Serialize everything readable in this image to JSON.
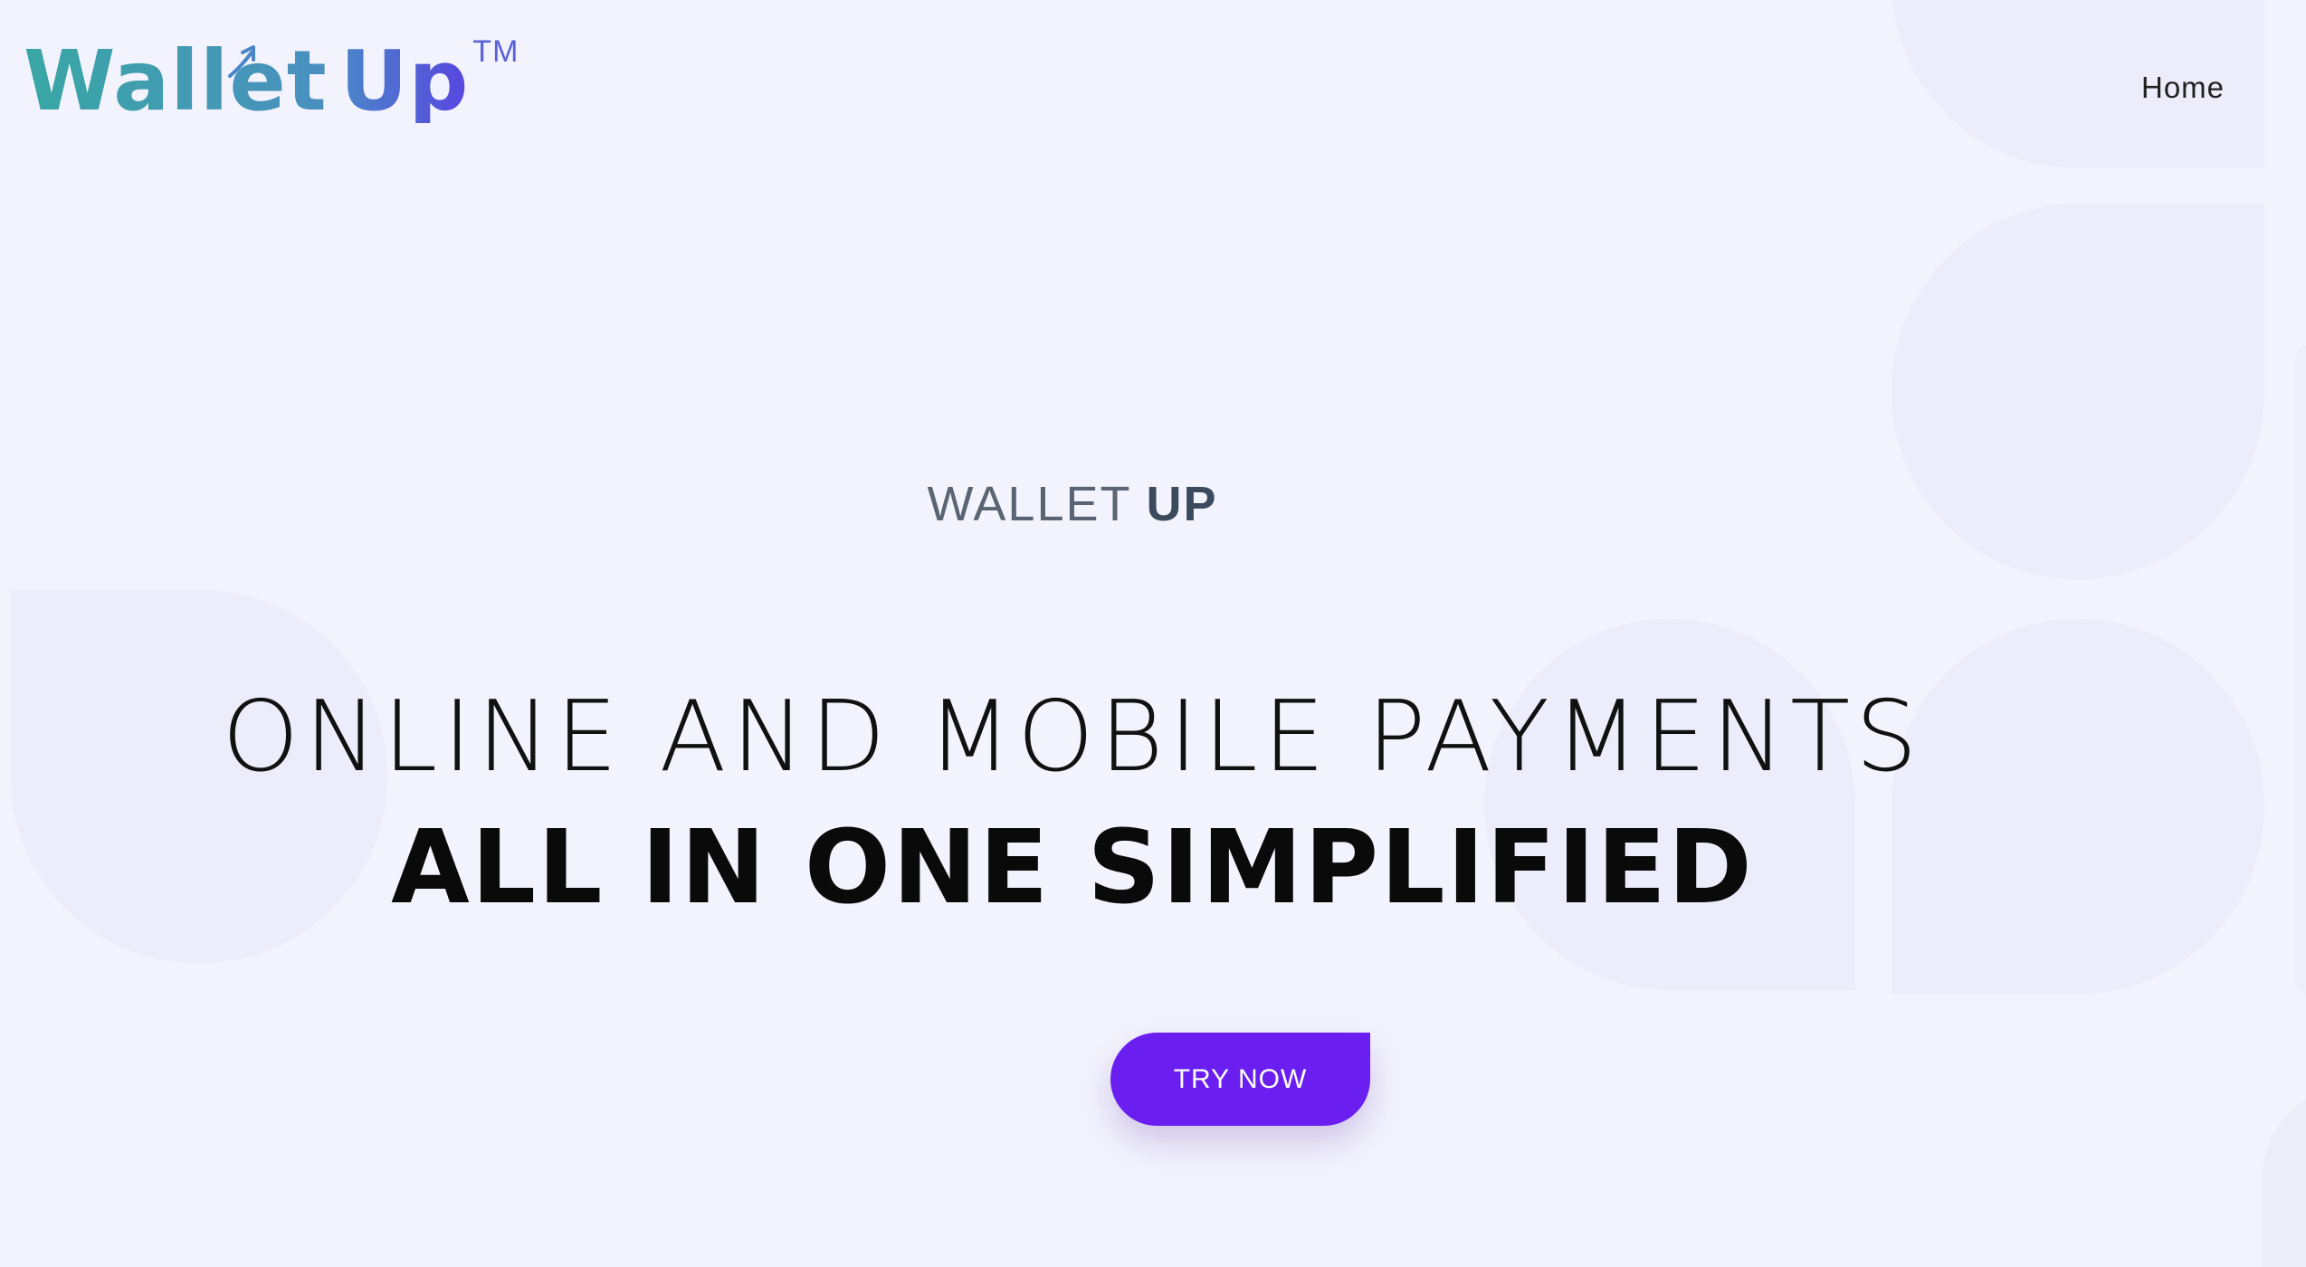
{
  "header": {
    "logo": {
      "wallet_text": "Wallet",
      "up_text": "Up",
      "tm_text": "TM"
    },
    "nav": [
      {
        "label": "Home"
      }
    ]
  },
  "hero": {
    "brand_light": "WALLET ",
    "brand_bold": "UP",
    "headline_line1": "ONLINE AND MOBILE PAYMENTS",
    "headline_line2": "ALL IN ONE SIMPLIFIED",
    "cta_label": "TRY NOW"
  },
  "colors": {
    "background": "#f3f3fd",
    "shape": "#ececfa",
    "cta": "#6a1ff0",
    "logo_teal": "#3fa3a8",
    "logo_purple": "#5845e0"
  }
}
